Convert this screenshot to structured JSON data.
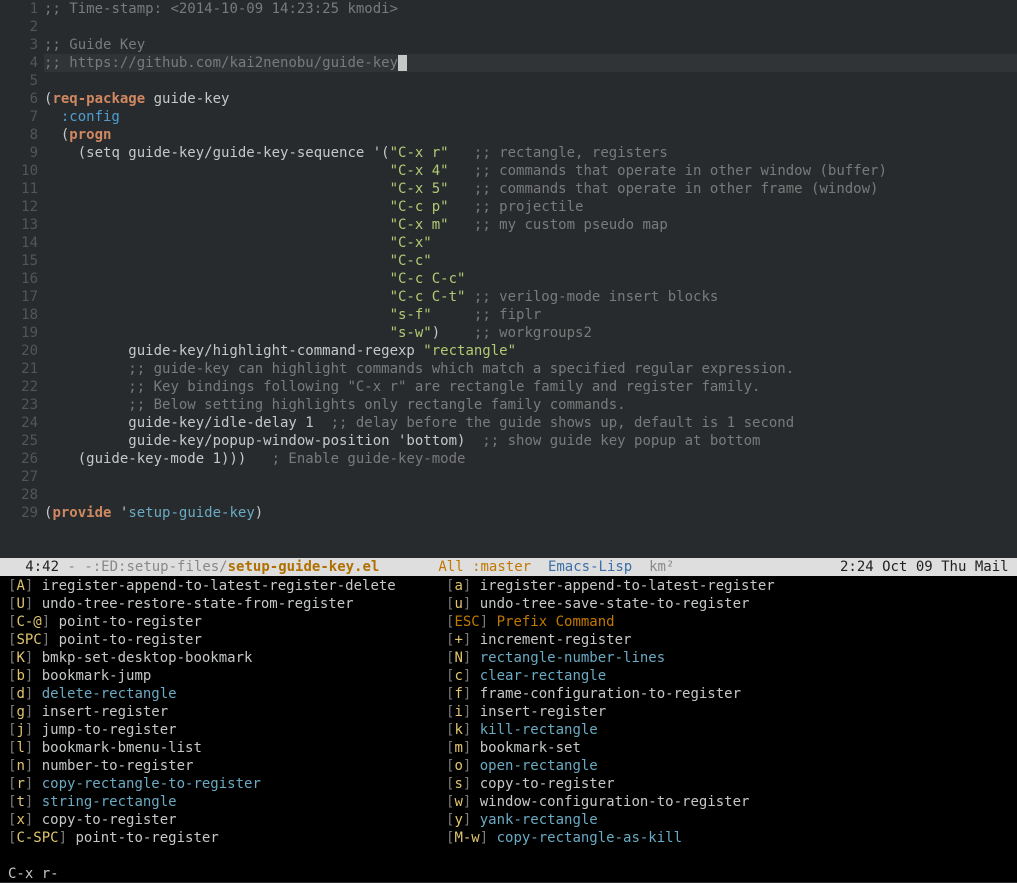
{
  "code": {
    "lines": [
      {
        "n": 1,
        "segs": [
          {
            "t": ";; ",
            "c": "comment"
          },
          {
            "t": "Time-stamp: <2014-10-09 14:23:25 kmodi>",
            "c": "comment"
          }
        ]
      },
      {
        "n": 2,
        "segs": []
      },
      {
        "n": 3,
        "segs": [
          {
            "t": ";; ",
            "c": "comment"
          },
          {
            "t": "Guide Key",
            "c": "comment"
          }
        ]
      },
      {
        "n": 4,
        "hl": true,
        "segs": [
          {
            "t": ";; ",
            "c": "comment"
          },
          {
            "t": "https://github.com/kai2nenobu/guide-key",
            "c": "comment"
          },
          {
            "cursor": true
          }
        ]
      },
      {
        "n": 5,
        "segs": []
      },
      {
        "n": 6,
        "segs": [
          {
            "t": "("
          },
          {
            "t": "req-package",
            "c": "keyword"
          },
          {
            "t": " guide-key"
          }
        ]
      },
      {
        "n": 7,
        "segs": [
          {
            "t": "  "
          },
          {
            "t": ":config",
            "c": "builtin"
          }
        ]
      },
      {
        "n": 8,
        "segs": [
          {
            "t": "  ("
          },
          {
            "t": "progn",
            "c": "keyword"
          }
        ]
      },
      {
        "n": 9,
        "segs": [
          {
            "t": "    ("
          },
          {
            "t": "setq"
          },
          {
            "t": " guide-key/guide-key-sequence '("
          },
          {
            "t": "\"C-x r\"",
            "c": "string"
          },
          {
            "t": "   "
          },
          {
            "t": ";; rectangle, registers",
            "c": "comment"
          }
        ]
      },
      {
        "n": 10,
        "segs": [
          {
            "t": "                                         "
          },
          {
            "t": "\"C-x 4\"",
            "c": "string"
          },
          {
            "t": "   "
          },
          {
            "t": ";; commands that operate in other window (buffer)",
            "c": "comment"
          }
        ]
      },
      {
        "n": 11,
        "segs": [
          {
            "t": "                                         "
          },
          {
            "t": "\"C-x 5\"",
            "c": "string"
          },
          {
            "t": "   "
          },
          {
            "t": ";; commands that operate in other frame (window)",
            "c": "comment"
          }
        ]
      },
      {
        "n": 12,
        "segs": [
          {
            "t": "                                         "
          },
          {
            "t": "\"C-c p\"",
            "c": "string"
          },
          {
            "t": "   "
          },
          {
            "t": ";; projectile",
            "c": "comment"
          }
        ]
      },
      {
        "n": 13,
        "segs": [
          {
            "t": "                                         "
          },
          {
            "t": "\"C-x m\"",
            "c": "string"
          },
          {
            "t": "   "
          },
          {
            "t": ";; my custom pseudo map",
            "c": "comment"
          }
        ]
      },
      {
        "n": 14,
        "segs": [
          {
            "t": "                                         "
          },
          {
            "t": "\"C-x\"",
            "c": "string"
          }
        ]
      },
      {
        "n": 15,
        "segs": [
          {
            "t": "                                         "
          },
          {
            "t": "\"C-c\"",
            "c": "string"
          }
        ]
      },
      {
        "n": 16,
        "segs": [
          {
            "t": "                                         "
          },
          {
            "t": "\"C-c C-c\"",
            "c": "string"
          }
        ]
      },
      {
        "n": 17,
        "segs": [
          {
            "t": "                                         "
          },
          {
            "t": "\"C-c C-t\"",
            "c": "string"
          },
          {
            "t": " "
          },
          {
            "t": ";; verilog-mode insert blocks",
            "c": "comment"
          }
        ]
      },
      {
        "n": 18,
        "segs": [
          {
            "t": "                                         "
          },
          {
            "t": "\"s-f\"",
            "c": "string"
          },
          {
            "t": "     "
          },
          {
            "t": ";; fiplr",
            "c": "comment"
          }
        ]
      },
      {
        "n": 19,
        "segs": [
          {
            "t": "                                         "
          },
          {
            "t": "\"s-w\"",
            "c": "string"
          },
          {
            "t": ")    "
          },
          {
            "t": ";; workgroups2",
            "c": "comment"
          }
        ]
      },
      {
        "n": 20,
        "segs": [
          {
            "t": "          guide-key/highlight-command-regexp "
          },
          {
            "t": "\"rectangle\"",
            "c": "string"
          }
        ]
      },
      {
        "n": 21,
        "segs": [
          {
            "t": "          "
          },
          {
            "t": ";; guide-key can highlight commands which match a specified regular expression.",
            "c": "comment"
          }
        ]
      },
      {
        "n": 22,
        "segs": [
          {
            "t": "          "
          },
          {
            "t": ";; Key bindings following \"C-x r\" are rectangle family and register family.",
            "c": "comment"
          }
        ]
      },
      {
        "n": 23,
        "segs": [
          {
            "t": "          "
          },
          {
            "t": ";; Below setting highlights only rectangle family commands.",
            "c": "comment"
          }
        ]
      },
      {
        "n": 24,
        "segs": [
          {
            "t": "          guide-key/idle-delay 1  "
          },
          {
            "t": ";; delay before the guide shows up, default is 1 second",
            "c": "comment"
          }
        ]
      },
      {
        "n": 25,
        "segs": [
          {
            "t": "          guide-key/popup-window-position 'bottom)  "
          },
          {
            "t": ";; show guide key popup at bottom",
            "c": "comment"
          }
        ]
      },
      {
        "n": 26,
        "segs": [
          {
            "t": "    (guide-key-mode 1)))   "
          },
          {
            "t": "; Enable guide-key-mode",
            "c": "comment"
          }
        ]
      },
      {
        "n": 27,
        "segs": []
      },
      {
        "n": 28,
        "segs": []
      },
      {
        "n": 29,
        "segs": [
          {
            "t": "("
          },
          {
            "t": "provide",
            "c": "keyword"
          },
          {
            "t": " '"
          },
          {
            "t": "setup-guide-key",
            "c": "symbol"
          },
          {
            "t": ")"
          }
        ]
      }
    ]
  },
  "modeline": {
    "pos": "4:42",
    "dash": " - ",
    "flags": "-:ED:",
    "path": "setup-files/",
    "file": "setup-guide-key.el",
    "vc": "All :master",
    "mode": "Emacs-Lisp",
    "minor": "km²",
    "time": "2:24 Oct 09 Thu Mail"
  },
  "guide": {
    "left": [
      {
        "key": "A",
        "cmd": "iregister-append-to-latest-register-delete"
      },
      {
        "key": "U",
        "cmd": "undo-tree-restore-state-from-register"
      },
      {
        "key": "C-@",
        "cmd": "point-to-register"
      },
      {
        "key": "SPC",
        "cmd": "point-to-register"
      },
      {
        "key": "K",
        "cmd": "bmkp-set-desktop-bookmark"
      },
      {
        "key": "b",
        "cmd": "bookmark-jump"
      },
      {
        "key": "d",
        "cmd": "delete-rectangle",
        "hl": true
      },
      {
        "key": "g",
        "cmd": "insert-register"
      },
      {
        "key": "j",
        "cmd": "jump-to-register"
      },
      {
        "key": "l",
        "cmd": "bookmark-bmenu-list"
      },
      {
        "key": "n",
        "cmd": "number-to-register"
      },
      {
        "key": "r",
        "cmd": "copy-rectangle-to-register",
        "hl": true
      },
      {
        "key": "t",
        "cmd": "string-rectangle",
        "hl": true
      },
      {
        "key": "x",
        "cmd": "copy-to-register"
      },
      {
        "key": "C-SPC",
        "cmd": "point-to-register"
      }
    ],
    "right": [
      {
        "key": "a",
        "cmd": "iregister-append-to-latest-register"
      },
      {
        "key": "u",
        "cmd": "undo-tree-save-state-to-register"
      },
      {
        "key": "ESC",
        "cmd": "Prefix Command",
        "prefix": true
      },
      {
        "key": "+",
        "cmd": "increment-register"
      },
      {
        "key": "N",
        "cmd": "rectangle-number-lines",
        "hl": true
      },
      {
        "key": "c",
        "cmd": "clear-rectangle",
        "hl": true
      },
      {
        "key": "f",
        "cmd": "frame-configuration-to-register"
      },
      {
        "key": "i",
        "cmd": "insert-register"
      },
      {
        "key": "k",
        "cmd": "kill-rectangle",
        "hl": true
      },
      {
        "key": "m",
        "cmd": "bookmark-set"
      },
      {
        "key": "o",
        "cmd": "open-rectangle",
        "hl": true
      },
      {
        "key": "s",
        "cmd": "copy-to-register"
      },
      {
        "key": "w",
        "cmd": "window-configuration-to-register"
      },
      {
        "key": "y",
        "cmd": "yank-rectangle",
        "hl": true
      },
      {
        "key": "M-w",
        "cmd": "copy-rectangle-as-kill",
        "hl": true
      }
    ]
  },
  "echo": "C-x r-"
}
